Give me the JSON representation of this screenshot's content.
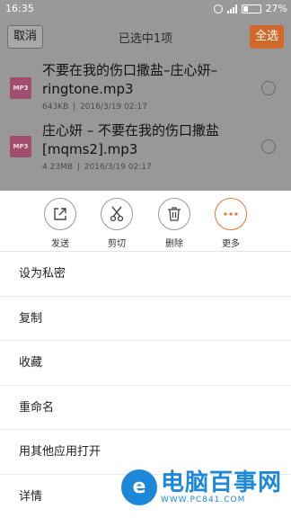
{
  "status_bar": {
    "time": "16:35",
    "battery_percent": "27%",
    "battery_level": 0.27,
    "icons": [
      "alarm-icon",
      "signal-icon",
      "battery-icon"
    ]
  },
  "header": {
    "cancel_label": "取消",
    "title": "已选中1项",
    "select_all_label": "全选",
    "accent_color": "#d0692a"
  },
  "files": [
    {
      "icon_label": "MP3",
      "name": "不要在我的伤口撒盐–庄心妍–ringtone.mp3",
      "size": "643KB",
      "date": "2016/3/19 02:17"
    },
    {
      "icon_label": "MP3",
      "name": "庄心妍 – 不要在我的伤口撒盐[mqms2].mp3",
      "size": "4.23MB",
      "date": "2016/3/19 02:17"
    }
  ],
  "actions": [
    {
      "icon": "share-icon",
      "label": "发送"
    },
    {
      "icon": "cut-icon",
      "label": "剪切"
    },
    {
      "icon": "delete-icon",
      "label": "删除"
    },
    {
      "icon": "more-icon",
      "label": "更多"
    }
  ],
  "menu": [
    "设为私密",
    "复制",
    "收藏",
    "重命名",
    "用其他应用打开",
    "详情"
  ],
  "watermark": {
    "logo_char": "e",
    "brand": "电脑百事网",
    "url": "WWW.PC841.COM"
  }
}
